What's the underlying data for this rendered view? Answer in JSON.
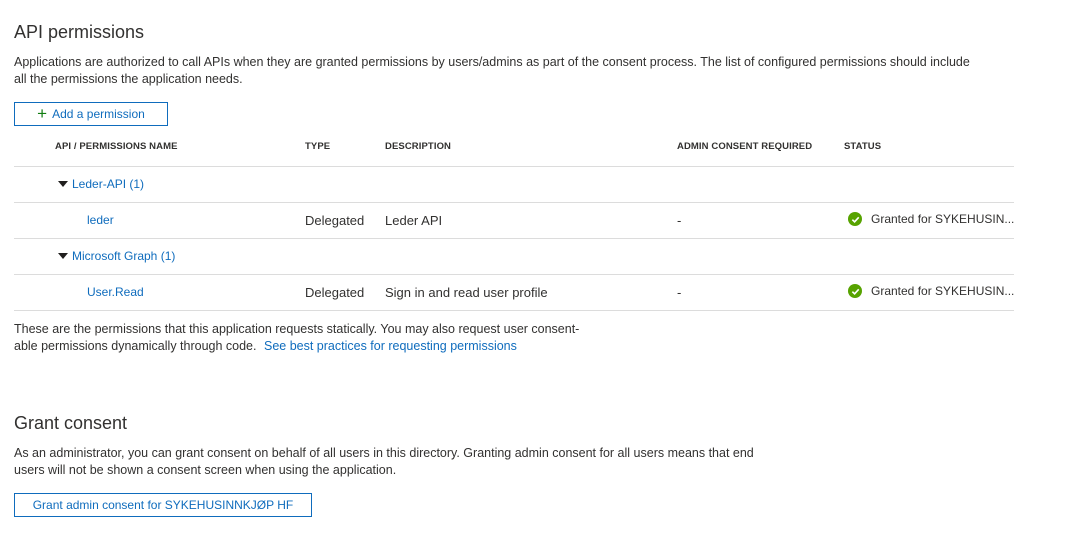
{
  "api_permissions": {
    "title": "API permissions",
    "description_line1": "Applications are authorized to call APIs when they are granted permissions by users/admins as part of the consent process. The list of configured permissions should include",
    "description_line2": "all the permissions the application needs.",
    "add_button_label": "Add a permission",
    "columns": {
      "name": "API / PERMISSIONS NAME",
      "type": "TYPE",
      "description": "DESCRIPTION",
      "admin_consent": "ADMIN CONSENT REQUIRED",
      "status": "STATUS"
    },
    "groups": [
      {
        "name": "Leder-API (1)",
        "permissions": [
          {
            "name": "leder",
            "type": "Delegated",
            "description": "Leder API",
            "admin_consent": "-",
            "status": "Granted for SYKEHUSIN..."
          }
        ]
      },
      {
        "name": "Microsoft Graph (1)",
        "permissions": [
          {
            "name": "User.Read",
            "type": "Delegated",
            "description": "Sign in and read user profile",
            "admin_consent": "-",
            "status": "Granted for SYKEHUSIN..."
          }
        ]
      }
    ],
    "footer_line1": "These are the permissions that this application requests statically. You may also request user consent-",
    "footer_line2": "able permissions dynamically through code.",
    "footer_link": "See best practices for requesting permissions"
  },
  "grant_consent": {
    "title": "Grant consent",
    "description_line1": "As an administrator, you can grant consent on behalf of all users in this directory. Granting admin consent for all users means that end",
    "description_line2": "users will not be shown a consent screen when using the application.",
    "button_label": "Grant admin consent for SYKEHUSINNKJØP HF"
  },
  "colors": {
    "link": "#0f6cbd",
    "granted": "#57a300",
    "add_icon": "#107c10"
  },
  "icons": [
    "add-icon",
    "caret-down-icon",
    "check-circle-icon"
  ]
}
